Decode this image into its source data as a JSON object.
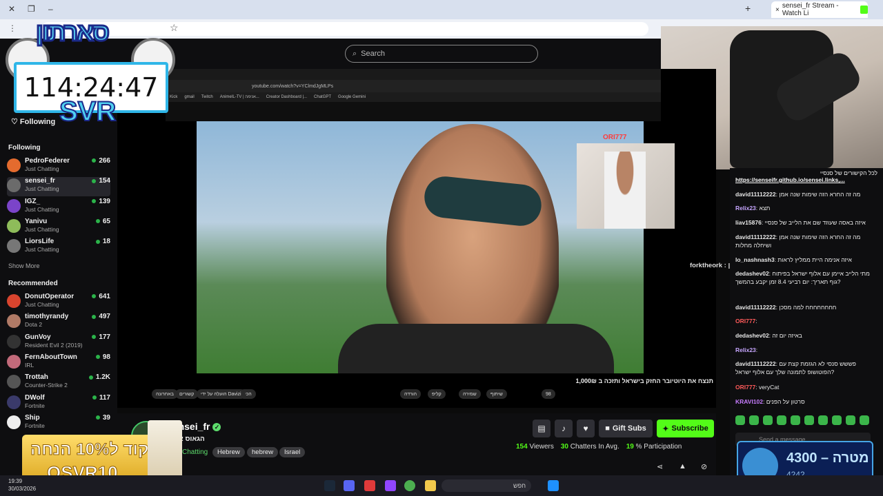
{
  "browser": {
    "tab_title": "sensei_fr Stream - Watch Li",
    "new_tab": "+",
    "close_tab": "×"
  },
  "site": {
    "search_placeholder": "Search",
    "following_top": "Following"
  },
  "sidebar": {
    "following_header": "Following",
    "following": [
      {
        "name": "PedroFederer",
        "category": "Just Chatting",
        "viewers": "266",
        "color": "#e46b2e"
      },
      {
        "name": "sensei_fr",
        "category": "Just Chatting",
        "viewers": "154",
        "color": "#6b6b6b"
      },
      {
        "name": "IGZ_",
        "category": "Just Chatting",
        "viewers": "139",
        "color": "#7b44c9"
      },
      {
        "name": "Yanivu",
        "category": "Just Chatting",
        "viewers": "65",
        "color": "#8ebc5a"
      },
      {
        "name": "LiorsLife",
        "category": "Just Chatting",
        "viewers": "18",
        "color": "#777"
      }
    ],
    "show_more": "Show More",
    "recommended_header": "Recommended",
    "recommended": [
      {
        "name": "DonutOperator",
        "category": "Just Chatting",
        "viewers": "641",
        "color": "#d8442e"
      },
      {
        "name": "timothyrandy",
        "category": "Dota 2",
        "viewers": "497",
        "color": "#b07a66"
      },
      {
        "name": "GunVoy",
        "category": "Resident Evil 2 (2019)",
        "viewers": "177",
        "color": "#333"
      },
      {
        "name": "FernAboutTown",
        "category": "IRL",
        "viewers": "98",
        "color": "#c26a7a"
      },
      {
        "name": "Trottah",
        "category": "Counter-Strike 2",
        "viewers": "1.2K",
        "color": "#555"
      },
      {
        "name": "DWolf",
        "category": "Fortnite",
        "viewers": "117",
        "color": "#3a3a6a"
      },
      {
        "name": "Ship",
        "category": "Fortnite",
        "viewers": "39",
        "color": "#eee"
      }
    ]
  },
  "overlay": {
    "timer": "114:24:47",
    "svr": "SVR",
    "logo_text": "סארתון",
    "promo_line1": "קוד ל10% הנחה",
    "promo_line2": "OSVR10",
    "goal_value": "4300 – מטרה",
    "goal_current": "4242"
  },
  "player": {
    "pip_name": "ORI777",
    "caption": "תנצח את היוטיובר החזק בישראל ותזכה ב 1,000₪",
    "chatter_overlay": "forktheork : סנסיי מקצוען",
    "inner_url": "youtube.com/watch?v=YClmdJgMLPs",
    "inner_bookmarks": [
      "Kick",
      "gmail",
      "Twitch",
      "AnimeIL-TV | אנימה...",
      "Creator Dashboard |...",
      "ChatGPT",
      "Google Gemini"
    ],
    "video_controls": [
      "הכל",
      "הועלה על ידי Davizi",
      "קשורים",
      "באחרונה",
      "הורדה",
      "קליפ",
      "שמירה",
      "שיתוף",
      "98"
    ]
  },
  "streamer": {
    "name": "sensei_fr",
    "title": "הגאוס איז ב",
    "category": "Chatting",
    "tags": [
      "Hebrew",
      "hebrew",
      "Israel"
    ],
    "gift_subs": "Gift Subs",
    "subscribe": "Subscribe",
    "viewers_num": "154",
    "viewers_label": "Viewers",
    "chatters_num": "30",
    "chatters_label": "Chatters In Avg.",
    "participation_num": "19",
    "participation_label": "% Participation"
  },
  "chat": {
    "pinned_text": "לכל הקישורים של סנסיי",
    "pinned_link": "https://senseifr.github.io/sensei.links,...",
    "messages": [
      {
        "user": "david11112222",
        "color": "#e8e8e8",
        "text": "מה זה החרא הזה שימות שנה אמן"
      },
      {
        "user": "Relix23",
        "color": "#c7a6ff",
        "text": "תצא"
      },
      {
        "user": "liav15876",
        "color": "#e8e8e8",
        "text": "איזה באסה שעוזד שם את הלייב של סנסיי"
      },
      {
        "user": "david11112222",
        "color": "#e8e8e8",
        "text": "מה זה החרא הזה שימות שנה אמן ושיחלה מחלות"
      },
      {
        "user": "lo_nashnash3",
        "color": "#e8e8e8",
        "text": "איזה אנימה היית ממליץ לראות"
      },
      {
        "user": "dedashev02",
        "color": "#e8e8e8",
        "text": "מתי הלייב איימן עם אלוף ישראל בפיתוח גוף תאריך: יום רביעי 8.4 זמן יקבע בהמשך?"
      },
      {
        "user": "david11112222",
        "color": "#e8e8e8",
        "text": "חחחחחחחח למה מסכן"
      },
      {
        "user": "ORI777",
        "color": "#ff5a5a",
        "text": ""
      },
      {
        "user": "dedashev02",
        "color": "#e8e8e8",
        "text": "באיזה יום זה"
      },
      {
        "user": "Relix23",
        "color": "#c7a6ff",
        "text": ""
      },
      {
        "user": "david11112222",
        "color": "#e8e8e8",
        "text": "פששש סנסי לא הגזמת קצת עם הפוטושופ לתמונה שלך עם אלוף ישראל?"
      },
      {
        "user": "ORI777",
        "color": "#ff5a5a",
        "text": "veryCat"
      },
      {
        "user": "KRAVI102",
        "color": "#c77dff",
        "text": "סרטון על הפנים"
      }
    ],
    "send_placeholder": "Send a message"
  },
  "taskbar": {
    "search_text": "חפש",
    "time": "19:39",
    "date": "30/03/2026"
  }
}
